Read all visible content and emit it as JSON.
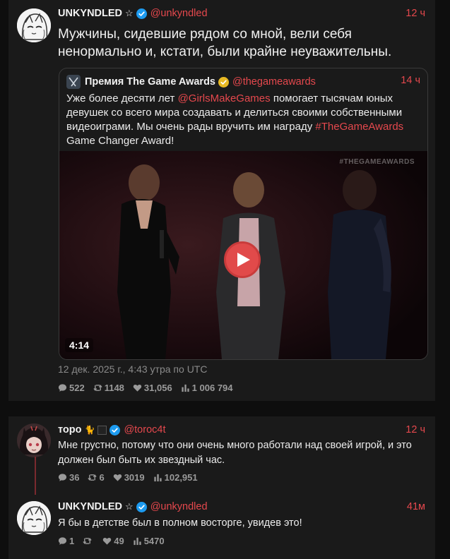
{
  "main_tweet": {
    "author_name": "UNKYNDLED",
    "author_badge": "☆",
    "handle": "@unkyndled",
    "time": "12 ч",
    "text": "Мужчины, сидевшие рядом со мной, вели себя ненормально и, кстати, были крайне неуважительны.",
    "date": "12 дек. 2025 г., 4:43 утра по UTC",
    "stats": {
      "replies": "522",
      "retweets": "1148",
      "likes": "31,056",
      "views": "1 006 794"
    }
  },
  "quote": {
    "author_name": "Премия The Game Awards",
    "handle": "@thegameawards",
    "time": "14 ч",
    "text_before": "Уже более десяти лет ",
    "mention": "@GirlsMakeGames",
    "text_middle": " помогает тысячам юных девушек со всего мира создавать и делиться своими собственными видеоиграми. Мы очень рады вручить им награду ",
    "hashtag": "#TheGameAwards",
    "text_after": " Game Changer Award!",
    "video": {
      "watermark": "#THEGAMEAWARDS",
      "duration": "4:14"
    }
  },
  "reply_1": {
    "author_name": "торо",
    "handle": "@toroc4t",
    "time": "12 ч",
    "text": "Мне грустно, потому что они очень много работали над своей игрой, и это должен был быть их звездный час.",
    "stats": {
      "replies": "36",
      "retweets": "6",
      "likes": "3019",
      "views": "102,951"
    }
  },
  "reply_2": {
    "author_name": "UNKYNDLED",
    "author_badge": "☆",
    "handle": "@unkyndled",
    "time": "41м",
    "text": "Я бы в детстве был в полном восторге, увидев это!",
    "stats": {
      "replies": "1",
      "retweets": "",
      "likes": "49",
      "views": "5470"
    }
  },
  "colors": {
    "accent": "#e5484d",
    "verified": "#1d9bf0",
    "gold": "#e8b923",
    "background": "#0e0e0e",
    "card": "#1a1a1a"
  }
}
